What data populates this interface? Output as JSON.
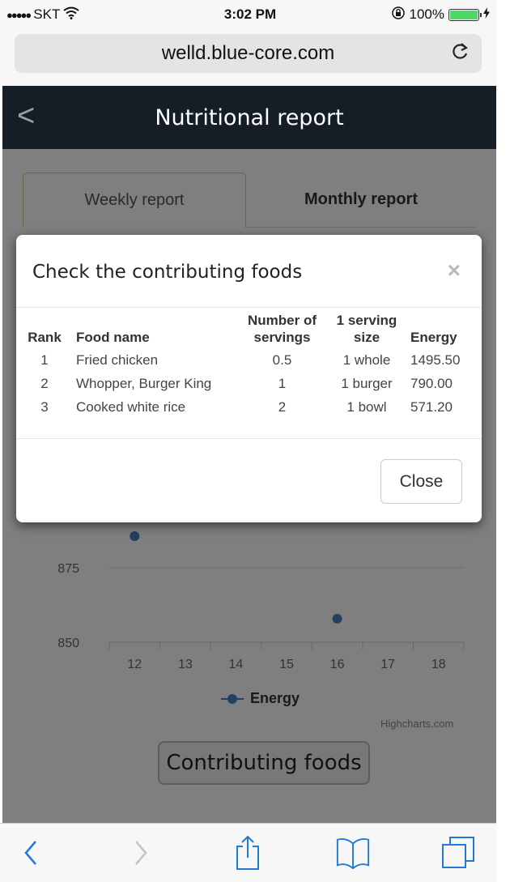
{
  "status_bar": {
    "carrier": "SKT",
    "signal_dots": "●●●●●",
    "time": "3:02 PM",
    "battery": "100%"
  },
  "browser": {
    "url": "welld.blue-core.com"
  },
  "app": {
    "title": "Nutritional report",
    "back_label": "<"
  },
  "tabs": [
    {
      "label": "Weekly report",
      "active": true
    },
    {
      "label": "Monthly report",
      "active": false
    }
  ],
  "chart_data": {
    "type": "scatter",
    "title": "",
    "xlabel": "",
    "ylabel": "",
    "x_ticks": [
      "12",
      "13",
      "14",
      "15",
      "16",
      "17",
      "18"
    ],
    "y_ticks": [
      "850",
      "875"
    ],
    "ylim": [
      850,
      900
    ],
    "series": [
      {
        "name": "Energy",
        "color": "#4a7fbf",
        "points": [
          {
            "x": 12,
            "y": 885.6
          },
          {
            "x": 16,
            "y": 857.9
          }
        ]
      }
    ],
    "legend": "bottom-center",
    "credits": "Highcharts.com",
    "grid": true
  },
  "contributing_button": "Contributing foods",
  "modal": {
    "title": "Check the contributing foods",
    "close_x": "×",
    "columns": [
      "Rank",
      "Food name",
      "Number of servings",
      "1 serving size",
      "Energy"
    ],
    "column_lines": [
      [
        "Rank"
      ],
      [
        "Food name"
      ],
      [
        "Number of",
        "servings"
      ],
      [
        "1 serving",
        "size"
      ],
      [
        "Energy"
      ]
    ],
    "rows": [
      {
        "rank": "1",
        "name": "Fried chicken",
        "servings": "0.5",
        "size": "1 whole",
        "energy": "1495.50"
      },
      {
        "rank": "2",
        "name": "Whopper, Burger King",
        "servings": "1",
        "size": "1 burger",
        "energy": "790.00"
      },
      {
        "rank": "3",
        "name": "Cooked white rice",
        "servings": "2",
        "size": "1 bowl",
        "energy": "571.20"
      }
    ],
    "close_label": "Close"
  },
  "toolbar": {
    "icons": [
      "back-icon",
      "forward-icon",
      "share-icon",
      "bookmarks-icon",
      "tabs-icon"
    ]
  }
}
